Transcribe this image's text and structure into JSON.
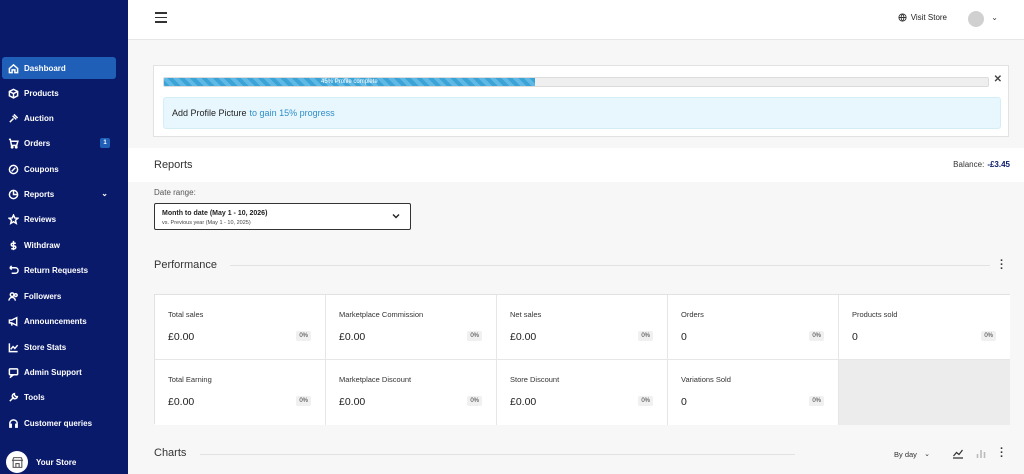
{
  "sidebar": {
    "items": [
      {
        "label": "Dashboard",
        "icon": "home-icon",
        "active": true
      },
      {
        "label": "Products",
        "icon": "box-icon"
      },
      {
        "label": "Auction",
        "icon": "gavel-icon"
      },
      {
        "label": "Orders",
        "icon": "cart-icon",
        "badge": "1"
      },
      {
        "label": "Coupons",
        "icon": "coupon-icon"
      },
      {
        "label": "Reports",
        "icon": "chart-icon",
        "has_submenu": true
      },
      {
        "label": "Reviews",
        "icon": "star-icon"
      },
      {
        "label": "Withdraw",
        "icon": "dollar-icon"
      },
      {
        "label": "Return Requests",
        "icon": "return-icon"
      },
      {
        "label": "Followers",
        "icon": "users-icon"
      },
      {
        "label": "Announcements",
        "icon": "megaphone-icon"
      },
      {
        "label": "Store Stats",
        "icon": "stats-icon"
      },
      {
        "label": "Admin Support",
        "icon": "support-icon"
      },
      {
        "label": "Tools",
        "icon": "wrench-icon"
      },
      {
        "label": "Customer queries",
        "icon": "headset-icon"
      }
    ],
    "store_label": "Your Store"
  },
  "topbar": {
    "visit_store": "Visit Store"
  },
  "progress": {
    "percent": 45,
    "text": "45% Profile complete",
    "notice": "Add Profile Picture",
    "notice_link": "to gain 15% progress"
  },
  "reports": {
    "title": "Reports",
    "balance_label": "Balance:",
    "balance_value": "-£3.45"
  },
  "date_range": {
    "label": "Date range:",
    "primary": "Month to date (May 1 - 10, 2026)",
    "secondary": "vs. Previous year (May 1 - 10, 2025)"
  },
  "performance": {
    "title": "Performance",
    "cards": [
      {
        "label": "Total sales",
        "value": "£0.00",
        "change": "0%"
      },
      {
        "label": "Marketplace Commission",
        "value": "£0.00",
        "change": "0%"
      },
      {
        "label": "Net sales",
        "value": "£0.00",
        "change": "0%"
      },
      {
        "label": "Orders",
        "value": "0",
        "change": "0%"
      },
      {
        "label": "Products sold",
        "value": "0",
        "change": "0%"
      },
      {
        "label": "Total Earning",
        "value": "£0.00",
        "change": "0%"
      },
      {
        "label": "Marketplace Discount",
        "value": "£0.00",
        "change": "0%"
      },
      {
        "label": "Store Discount",
        "value": "£0.00",
        "change": "0%"
      },
      {
        "label": "Variations Sold",
        "value": "0",
        "change": "0%"
      }
    ]
  },
  "charts": {
    "title": "Charts",
    "interval": "By day"
  }
}
